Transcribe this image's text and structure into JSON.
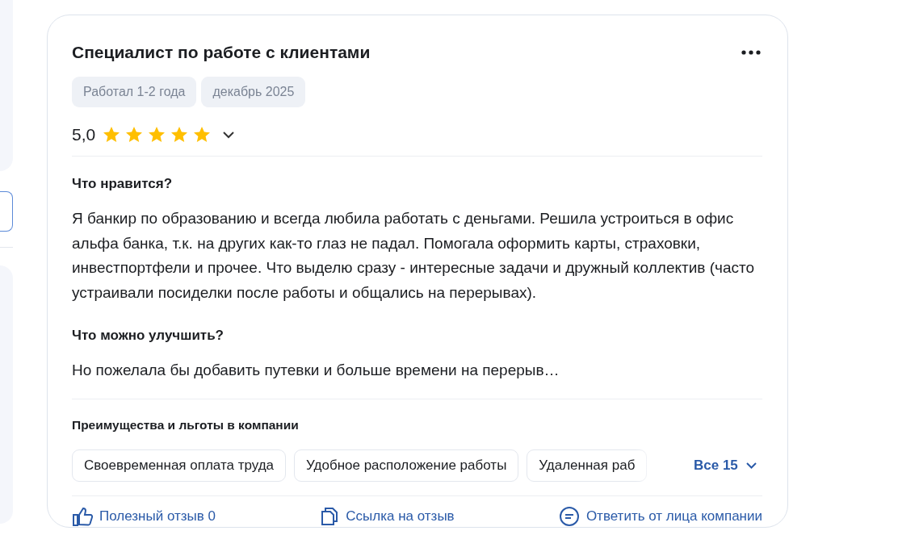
{
  "review": {
    "title": "Специалист по работе с клиентами",
    "tags": [
      "Работал 1-2 года",
      "декабрь 2025"
    ],
    "rating": {
      "value": "5,0",
      "stars": 5
    },
    "sections": [
      {
        "heading": "Что нравится?",
        "text": "Я банкир по образованию и всегда любила работать с деньгами. Решила устроиться в офис альфа банка, т.к. на других как-то глаз не падал. Помогала оформить карты, страховки, инвестпортфели и прочее. Что выделю сразу - интересные задачи и дружный коллектив (часто устраивали посиделки после работы и общались на перерывах)."
      },
      {
        "heading": "Что можно улучшить?",
        "text": "Но пожелала бы добавить путевки и больше времени на перерыв…"
      }
    ],
    "benefits": {
      "heading": "Преимущества и льготы в компании",
      "items": [
        "Своевременная оплата труда",
        "Удобное расположение работы",
        "Удаленная раб"
      ],
      "more": "Все 15"
    },
    "actions": [
      {
        "kind": "like",
        "label": "Полезный отзыв 0"
      },
      {
        "kind": "link",
        "label": "Ссылка на отзыв"
      },
      {
        "kind": "reply",
        "label": "Ответить от лица компании"
      }
    ]
  }
}
